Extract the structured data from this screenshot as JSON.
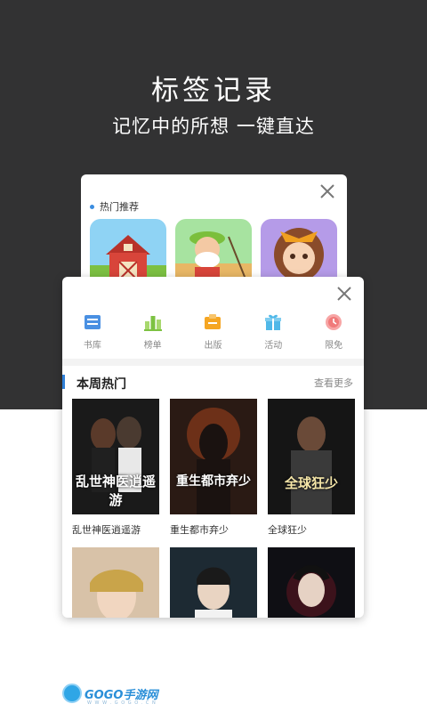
{
  "hero": {
    "title": "标签记录",
    "subtitle": "记忆中的所想 一键直达"
  },
  "back_card": {
    "section_title": "热门推荐",
    "games": [
      {
        "icon": "barn-icon"
      },
      {
        "icon": "farmer-fishing-icon"
      },
      {
        "icon": "girl-character-icon"
      }
    ]
  },
  "front_card": {
    "categories": [
      {
        "label": "书库",
        "icon": "bookshelf-icon",
        "color": "#4a90e2"
      },
      {
        "label": "榜单",
        "icon": "ranking-icon",
        "color": "#7dc242"
      },
      {
        "label": "出版",
        "icon": "publish-icon",
        "color": "#f5a623"
      },
      {
        "label": "活动",
        "icon": "gift-icon",
        "color": "#50b8e8"
      },
      {
        "label": "限免",
        "icon": "clock-icon",
        "color": "#f07a7a"
      }
    ],
    "section_title": "本周热门",
    "more_label": "查看更多",
    "books": [
      {
        "title": "乱世神医逍遥游",
        "cover_text": "乱世神医逍遥游"
      },
      {
        "title": "重生都市弃少",
        "cover_text": "重生都市弃少"
      },
      {
        "title": "全球狂少",
        "cover_text": "全球狂少"
      }
    ]
  },
  "logo": {
    "text": "GOGO手游网",
    "sub": "W W W . G O G O . C N"
  }
}
